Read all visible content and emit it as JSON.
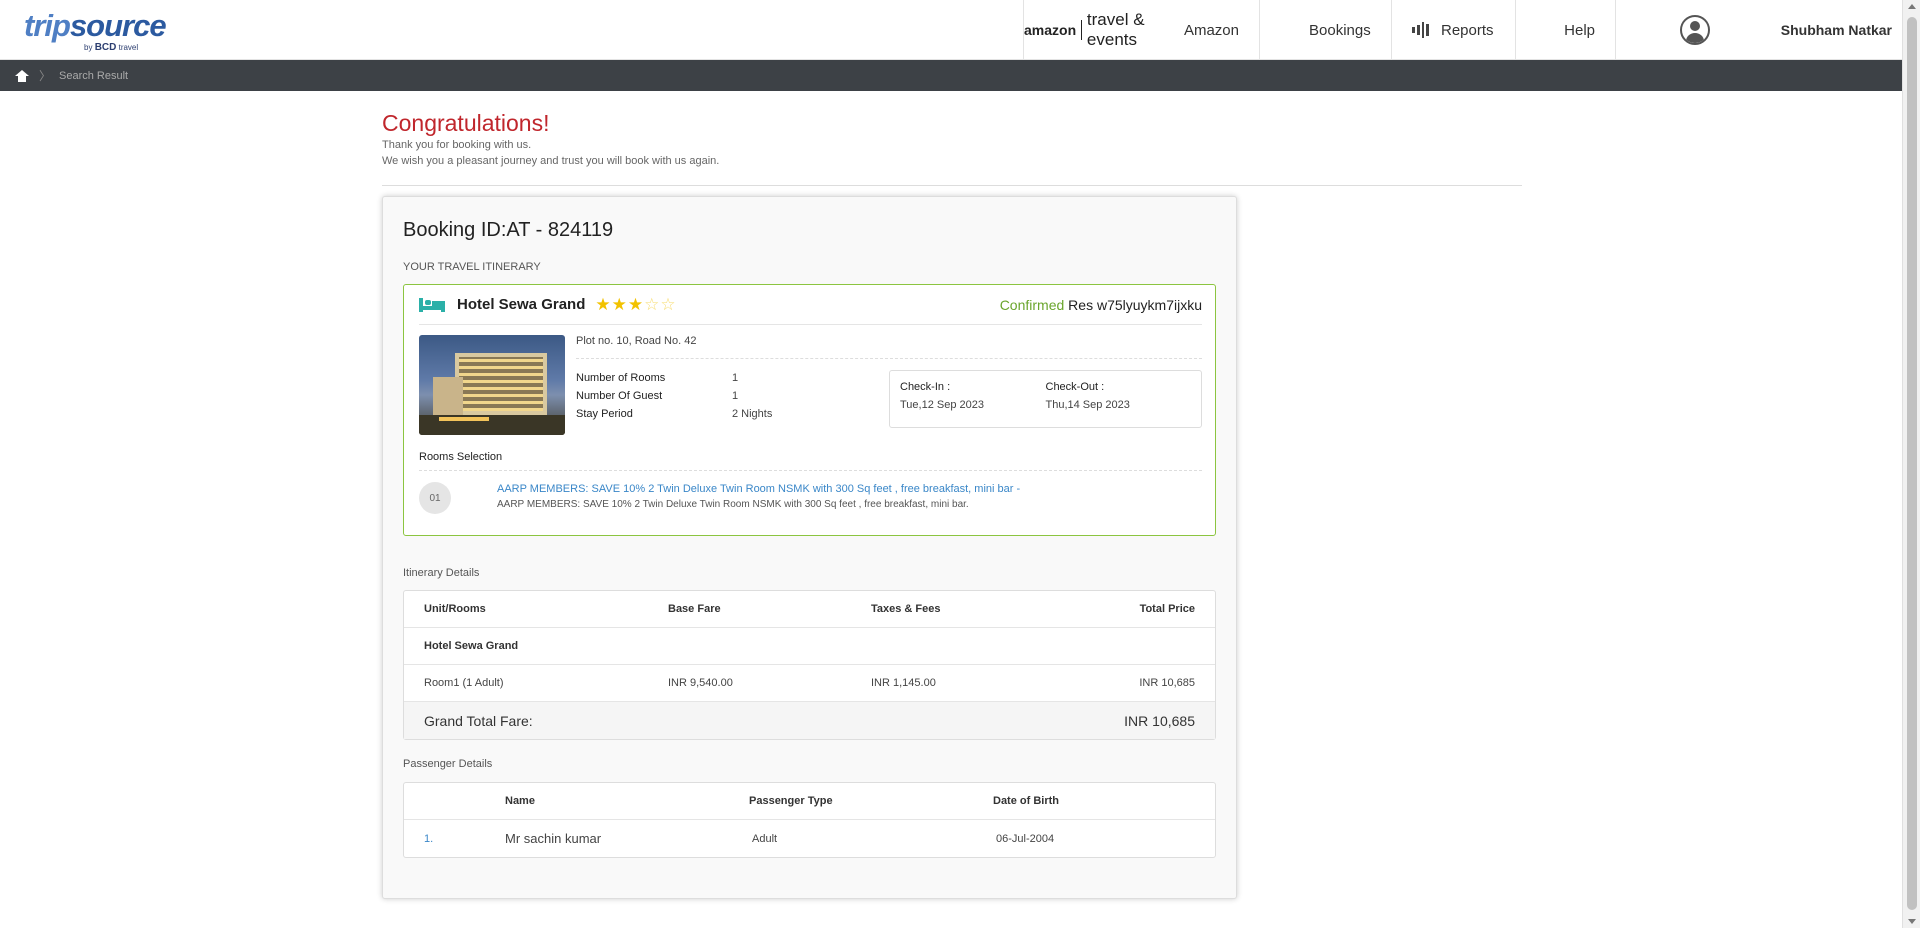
{
  "brand": {
    "logo_main_a": "trip",
    "logo_main_b": "source",
    "logo_by": "by",
    "logo_bcd": "BCD",
    "logo_travel": "travel"
  },
  "nav": {
    "amazon_logo_a": "amazon",
    "amazon_logo_b": "travel & events",
    "amazon_name": "Amazon",
    "bookings": "Bookings",
    "reports": "Reports",
    "help": "Help",
    "user_name": "Shubham Natkar"
  },
  "breadcrumb": {
    "current": "Search Result"
  },
  "congrats": {
    "title": "Congratulations!",
    "line1": "Thank you for booking with us.",
    "line2": "We wish you a pleasant journey and trust you will book with us again."
  },
  "booking": {
    "id_label": "Booking ID:AT - 824119",
    "itinerary_label": "YOUR TRAVEL ITINERARY",
    "hotel_name": "Hotel Sewa Grand",
    "stars_rating": 3,
    "stars_total": 5,
    "status": "Confirmed",
    "res": "Res w75lyuykm7ijxku",
    "address": "Plot no. 10, Road No. 42",
    "details": [
      {
        "label": "Number of Rooms",
        "value": "1"
      },
      {
        "label": "Number Of Guest",
        "value": "1"
      },
      {
        "label": "Stay Period",
        "value": "2 Nights"
      }
    ],
    "checkin_label": "Check-In :",
    "checkin_value": "Tue,12 Sep 2023",
    "checkout_label": "Check-Out :",
    "checkout_value": "Thu,14 Sep 2023",
    "rooms_title": "Rooms Selection",
    "room_number": "01",
    "room_link": "AARP MEMBERS: SAVE 10% 2 Twin Deluxe Twin Room NSMK with 300 Sq feet , free breakfast, mini bar -",
    "room_desc": "AARP MEMBERS: SAVE 10% 2 Twin Deluxe Twin Room NSMK with 300 Sq feet , free breakfast, mini bar."
  },
  "itinerary": {
    "title": "Itinerary Details",
    "headers": [
      "Unit/Rooms",
      "Base Fare",
      "Taxes & Fees",
      "Total Price"
    ],
    "hotel_row": "Hotel Sewa Grand",
    "rows": [
      [
        "Room1 (1 Adult)",
        "INR 9,540.00",
        "INR 1,145.00",
        "INR 10,685"
      ]
    ],
    "grand_label": "Grand Total Fare:",
    "grand_value": "INR 10,685"
  },
  "passengers": {
    "title": "Passenger Details",
    "headers": [
      "",
      "Name",
      "Passenger Type",
      "Date of Birth"
    ],
    "rows": [
      [
        "1.",
        "Mr sachin kumar",
        "Adult",
        "06-Jul-2004"
      ]
    ]
  },
  "colors": {
    "accent_red": "#c0262c",
    "confirmed_green": "#6aa52c",
    "link_blue": "#3a87c8",
    "border_green": "#8cc540",
    "bed_teal": "#2bb0a8",
    "star_yellow": "#f2c200"
  }
}
